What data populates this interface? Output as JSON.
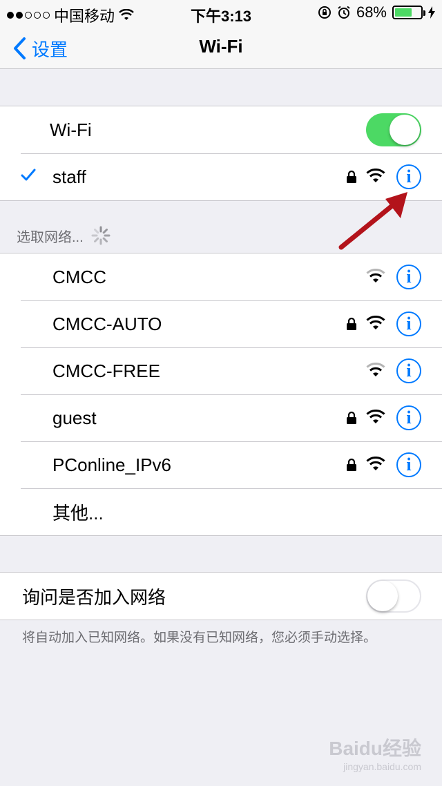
{
  "status_bar": {
    "carrier": "中国移动",
    "time": "下午3:13",
    "battery_percent": "68%",
    "battery_level": 0.68,
    "signal_dots_filled": 2,
    "signal_dots_total": 5
  },
  "nav": {
    "back_label": "设置",
    "title": "Wi-Fi"
  },
  "wifi_section": {
    "wifi_label": "Wi-Fi",
    "wifi_enabled": true,
    "connected_network": "staff",
    "connected_locked": true
  },
  "choose_network": {
    "header": "选取网络...",
    "networks": [
      {
        "name": "CMCC",
        "locked": false,
        "strong": false
      },
      {
        "name": "CMCC-AUTO",
        "locked": true,
        "strong": true
      },
      {
        "name": "CMCC-FREE",
        "locked": false,
        "strong": false
      },
      {
        "name": "guest",
        "locked": true,
        "strong": true
      },
      {
        "name": "PConline_IPv6",
        "locked": true,
        "strong": true
      }
    ],
    "other_label": "其他..."
  },
  "ask_join": {
    "label": "询问是否加入网络",
    "enabled": false,
    "footer": "将自动加入已知网络。如果没有已知网络，您必须手动选择。"
  },
  "watermark": {
    "brand": "Baidu经验",
    "url": "jingyan.baidu.com"
  },
  "colors": {
    "accent": "#007aff",
    "toggle_on": "#4cd964",
    "background": "#efeff4",
    "arrow": "#b3131b"
  },
  "icons": {
    "back": "chevron-left-icon",
    "check": "checkmark-icon",
    "lock": "lock-icon",
    "wifi": "wifi-icon",
    "info": "info-icon",
    "spinner": "spinner-icon"
  }
}
